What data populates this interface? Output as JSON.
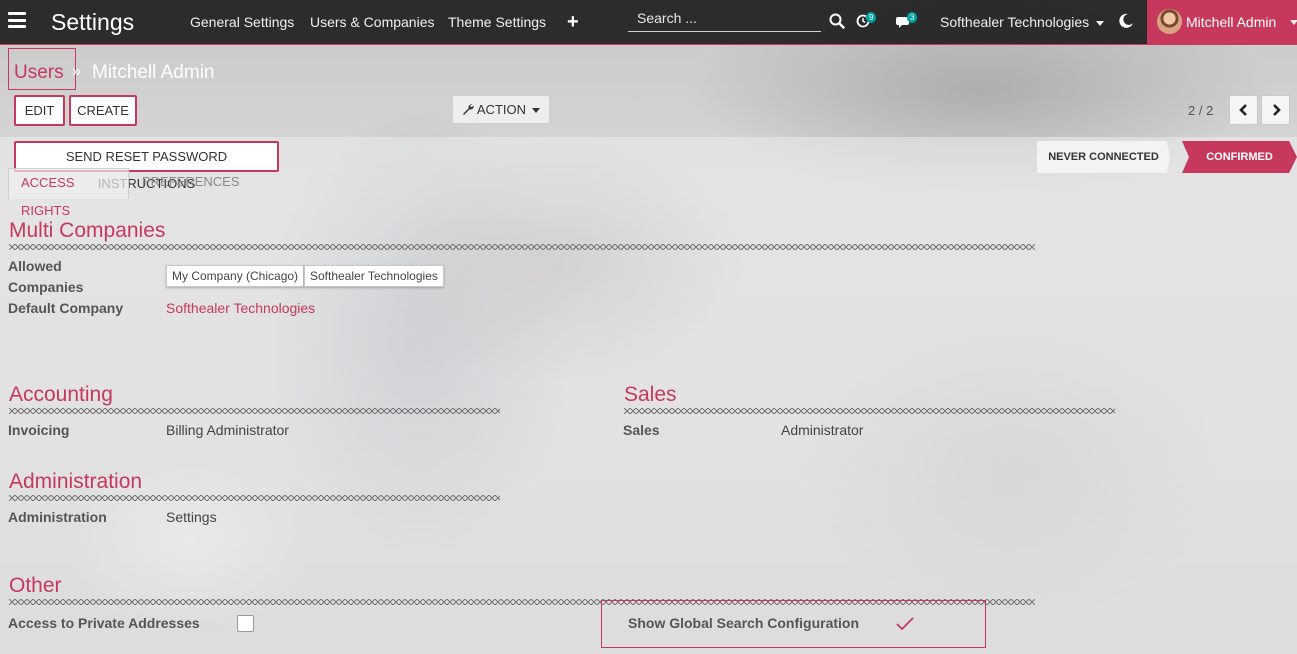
{
  "navbar": {
    "app_title": "Settings",
    "menu": [
      "General Settings",
      "Users & Companies",
      "Theme Settings"
    ],
    "search_placeholder": "Search ...",
    "activity_badge": "9",
    "messages_badge": "3",
    "company": "Softhealer Technologies",
    "user_name": "Mitchell Admin"
  },
  "breadcrumb": {
    "parent": "Users",
    "separator": "»",
    "current": "Mitchell Admin"
  },
  "buttons": {
    "edit": "EDIT",
    "create": "CREATE",
    "action": "ACTION",
    "reset_password": "SEND RESET PASSWORD INSTRUCTIONS"
  },
  "pager": {
    "value": "2 / 2"
  },
  "statusbar": {
    "stages": [
      "NEVER CONNECTED",
      "CONFIRMED"
    ],
    "active": "CONFIRMED"
  },
  "tabs": [
    "ACCESS RIGHTS",
    "PREFERENCES"
  ],
  "sections": {
    "multi_companies": {
      "title": "Multi Companies",
      "allowed_label_line1": "Allowed",
      "allowed_label_line2": "Companies",
      "allowed_tags": [
        "My Company (Chicago)",
        "Softhealer Technologies"
      ],
      "default_label": "Default Company",
      "default_value": "Softhealer Technologies"
    },
    "accounting": {
      "title": "Accounting",
      "field_label": "Invoicing",
      "field_value": "Billing Administrator"
    },
    "sales": {
      "title": "Sales",
      "field_label": "Sales",
      "field_value": "Administrator"
    },
    "administration": {
      "title": "Administration",
      "field_label": "Administration",
      "field_value": "Settings"
    },
    "other": {
      "title": "Other",
      "private_addresses_label": "Access to Private Addresses",
      "private_addresses_checked": false,
      "global_search_label": "Show Global Search Configuration",
      "global_search_checked": true
    }
  },
  "colors": {
    "brand": "#c7395c",
    "navbar": "#1e1e1e",
    "badge": "#00a09d"
  }
}
